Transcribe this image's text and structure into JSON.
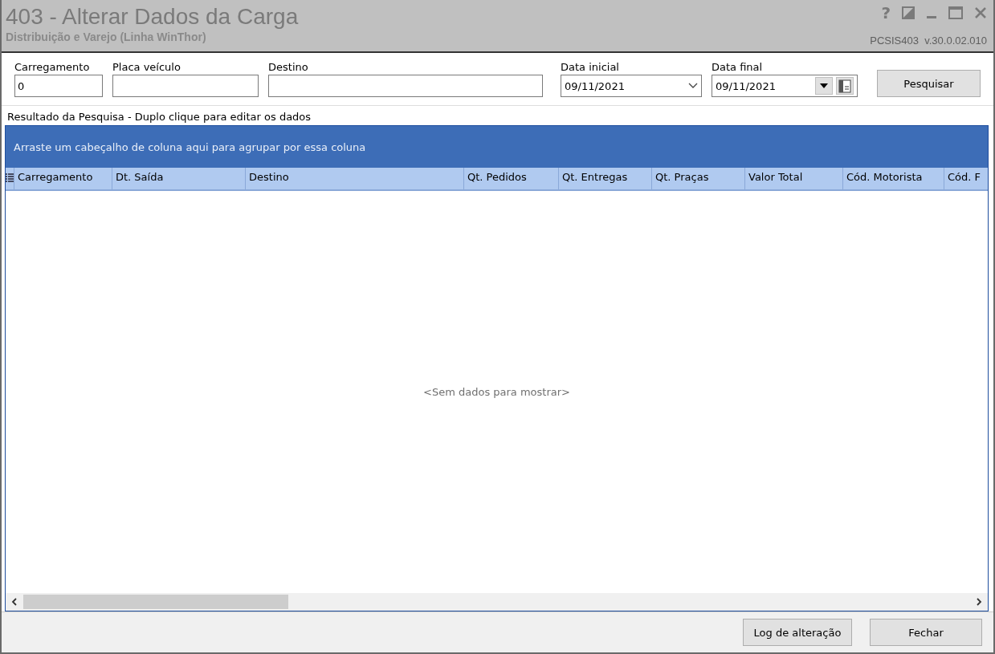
{
  "window": {
    "title": "403 - Alterar Dados da Carga",
    "subtitle": "Distribuição e Varejo (Linha WinThor)",
    "version": "PCSIS403  v.30.0.02.010",
    "controls": [
      "?"
    ]
  },
  "filters": [
    {
      "kind": "text",
      "label": "Carregamento",
      "value": "0"
    },
    {
      "kind": "text",
      "label": "Placa veículo"
    },
    {
      "kind": "text",
      "label": "Destino"
    },
    {
      "kind": "date",
      "label": "Data inicial",
      "value": "09/11/2021"
    },
    {
      "kind": "datecal",
      "label": "Data final",
      "value": "09/11/2021"
    }
  ],
  "search_button": "Pesquisar",
  "results": {
    "title": "Resultado da Pesquisa - Duplo clique para editar os dados",
    "group_hint": "Arraste um cabeçalho de coluna aqui para agrupar por essa coluna",
    "columns": [
      "Carregamento",
      "Dt. Saída",
      "Destino",
      "Qt. Pedidos",
      "Qt. Entregas",
      "Qt. Praças",
      "Valor Total",
      "Cód. Motorista",
      "Cód. F"
    ],
    "empty_text": "<Sem dados para mostrar>"
  },
  "footer_buttons": [
    "Log de alteração",
    "Fechar"
  ]
}
